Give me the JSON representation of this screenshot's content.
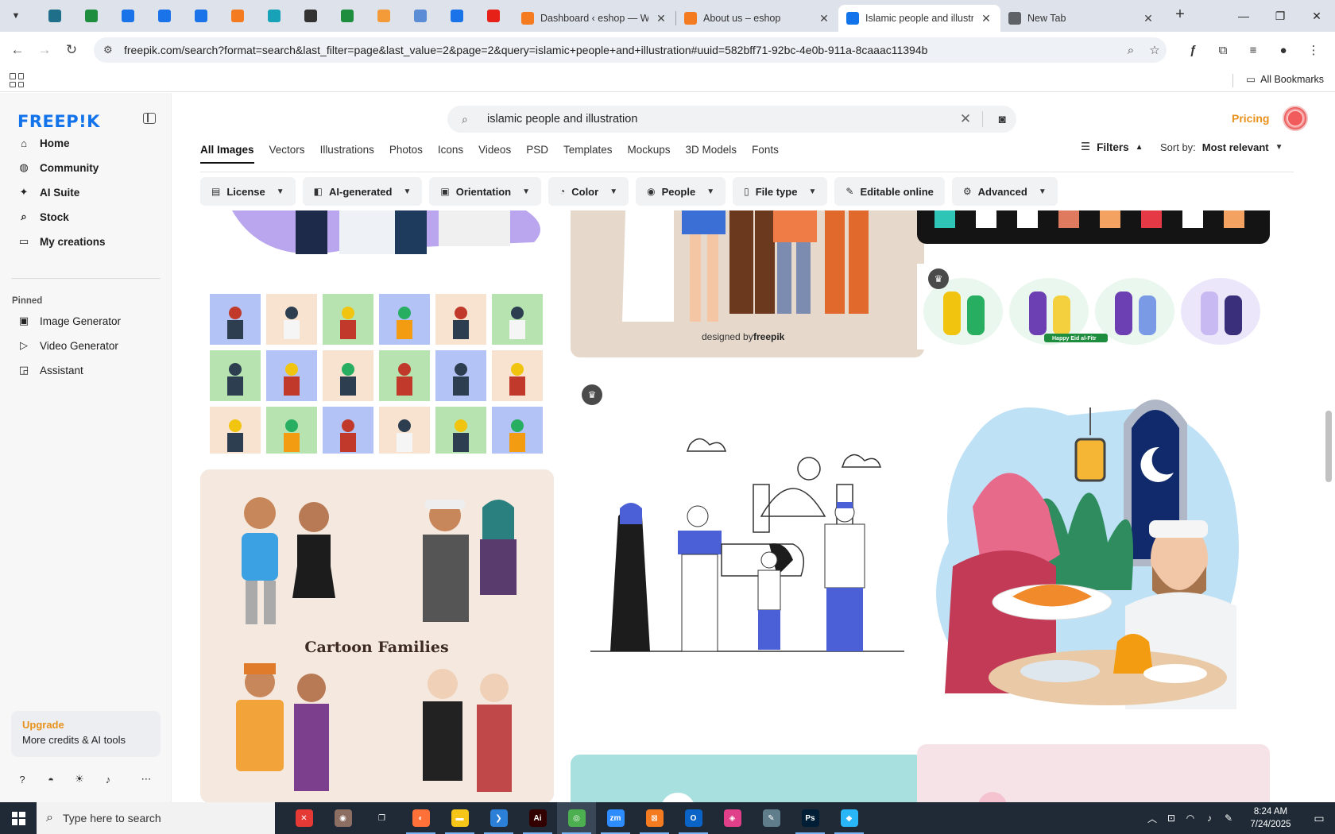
{
  "browser": {
    "pinned_tabs": [
      {
        "icon": "wordpress-icon",
        "color": "#1f6f8b"
      },
      {
        "icon": "sheets-icon",
        "color": "#1e8e3e"
      },
      {
        "icon": "docs-icon",
        "color": "#1a73e8"
      },
      {
        "icon": "docs-icon",
        "color": "#1a73e8"
      },
      {
        "icon": "docs-icon",
        "color": "#1a73e8"
      },
      {
        "icon": "xampp-icon",
        "color": "#f47b20"
      },
      {
        "icon": "app-icon",
        "color": "#17a2b8"
      },
      {
        "icon": "openai-icon",
        "color": "#333333"
      },
      {
        "icon": "sheets-icon",
        "color": "#1e8e3e"
      },
      {
        "icon": "hand-icon",
        "color": "#f29b38"
      },
      {
        "icon": "grid-icon",
        "color": "#5b8dd6"
      },
      {
        "icon": "forms-icon",
        "color": "#1a73e8"
      },
      {
        "icon": "youtube-icon",
        "color": "#e62117"
      }
    ],
    "tabs": [
      {
        "title": "Dashboard ‹ eshop — W…",
        "icon": "xampp-icon",
        "color": "#f47b20",
        "active": false
      },
      {
        "title": "About us – eshop",
        "icon": "xampp-icon",
        "color": "#f47b20",
        "active": false
      },
      {
        "title": "Islamic people and illustr…",
        "icon": "freepik-icon",
        "color": "#1273eb",
        "active": true
      },
      {
        "title": "New Tab",
        "icon": "chrome-icon",
        "color": "#5f6368",
        "active": false
      }
    ],
    "url": "freepik.com/search?format=search&last_filter=page&last_value=2&page=2&query=islamic+people+and+illustration#uuid=582bff71-92bc-4e0b-911a-8caaac11394b",
    "all_bookmarks": "All Bookmarks"
  },
  "sidebar": {
    "logo": "FREEP!K",
    "items": [
      {
        "label": "Home",
        "icon": "home-icon",
        "glyph": "⌂"
      },
      {
        "label": "Community",
        "icon": "globe-icon",
        "glyph": "◍"
      },
      {
        "label": "AI Suite",
        "icon": "sparkle-icon",
        "glyph": "✦"
      },
      {
        "label": "Stock",
        "icon": "search-icon",
        "glyph": "⌕"
      },
      {
        "label": "My creations",
        "icon": "folder-icon",
        "glyph": "▭"
      }
    ],
    "pinned_title": "Pinned",
    "pinned": [
      {
        "label": "Image Generator",
        "icon": "image-icon",
        "glyph": "▣"
      },
      {
        "label": "Video Generator",
        "icon": "video-icon",
        "glyph": "▷"
      },
      {
        "label": "Assistant",
        "icon": "chat-icon",
        "glyph": "◲"
      }
    ],
    "upgrade_title": "Upgrade",
    "upgrade_sub": "More credits & AI tools"
  },
  "header": {
    "search_value": "islamic people and illustration",
    "pricing": "Pricing"
  },
  "categories": [
    "All Images",
    "Vectors",
    "Illustrations",
    "Photos",
    "Icons",
    "Videos",
    "PSD",
    "Templates",
    "Mockups",
    "3D Models",
    "Fonts"
  ],
  "filters_label": "Filters",
  "sort": {
    "label": "Sort by:",
    "value": "Most relevant"
  },
  "chips": [
    {
      "label": "License",
      "icon": "license-icon"
    },
    {
      "label": "AI-generated",
      "icon": "ai-icon"
    },
    {
      "label": "Orientation",
      "icon": "orientation-icon"
    },
    {
      "label": "Color",
      "icon": "color-icon"
    },
    {
      "label": "People",
      "icon": "people-icon"
    },
    {
      "label": "File type",
      "icon": "file-icon"
    },
    {
      "label": "Editable online",
      "icon": "pen-icon"
    },
    {
      "label": "Advanced",
      "icon": "gear-icon"
    }
  ],
  "results": {
    "designed_by": "designed by",
    "freepik_mark": "freepik",
    "cartoon_title": "Cartoon Families",
    "eid_banner": "Happy Eid al-Fitr"
  },
  "taskbar": {
    "search_placeholder": "Type here to search",
    "time": "8:24 AM",
    "date": "7/24/2025",
    "apps": [
      {
        "icon": "app-icon",
        "color": "#e53935",
        "glyph": "✕"
      },
      {
        "icon": "app-icon",
        "color": "#8d6e63",
        "glyph": "◉"
      },
      {
        "icon": "task-view-icon",
        "color": "#1f2a36",
        "glyph": "❐"
      },
      {
        "icon": "firefox-icon",
        "color": "#ff7139",
        "glyph": "◐"
      },
      {
        "icon": "explorer-icon",
        "color": "#f5c518",
        "glyph": "▬"
      },
      {
        "icon": "vscode-icon",
        "color": "#2b7fd6",
        "glyph": "❯"
      },
      {
        "icon": "illustrator-icon",
        "color": "#330000",
        "glyph": "Ai"
      },
      {
        "icon": "chrome-icon",
        "color": "#4caf50",
        "glyph": "◎"
      },
      {
        "icon": "zoom-icon",
        "color": "#2d8cff",
        "glyph": "zm"
      },
      {
        "icon": "xampp-icon",
        "color": "#f47b20",
        "glyph": "⊠"
      },
      {
        "icon": "outlook-icon",
        "color": "#0a64c8",
        "glyph": "O"
      },
      {
        "icon": "app-icon",
        "color": "#e0408a",
        "glyph": "◈"
      },
      {
        "icon": "pen-icon",
        "color": "#607d8b",
        "glyph": "✎"
      },
      {
        "icon": "photoshop-icon",
        "color": "#001e36",
        "glyph": "Ps"
      },
      {
        "icon": "app-icon",
        "color": "#29b6f6",
        "glyph": "◆"
      }
    ]
  }
}
